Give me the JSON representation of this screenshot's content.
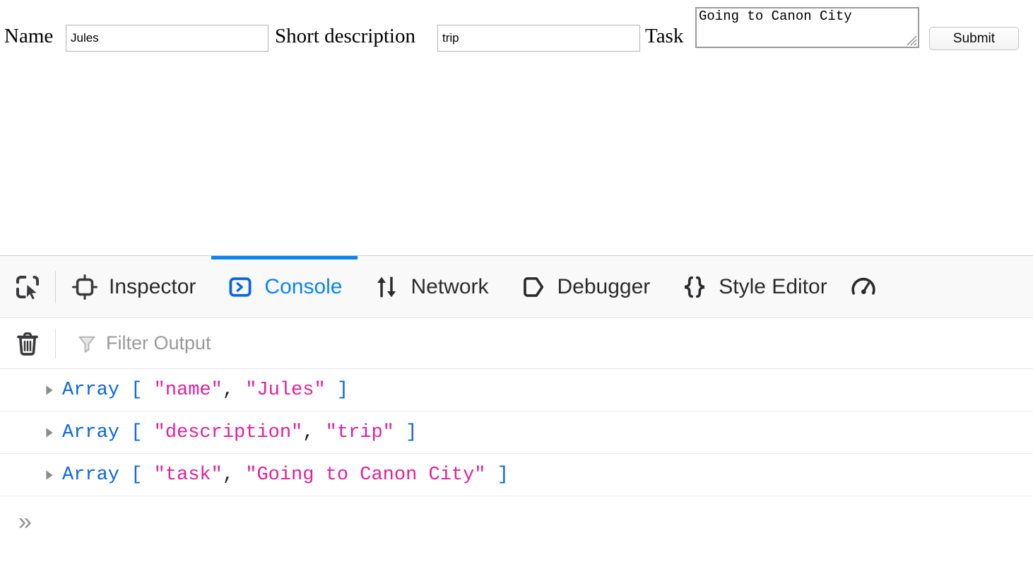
{
  "page": {
    "form": {
      "name_label": "Name",
      "name_value": "Jules",
      "name_placeholder": "",
      "description_label": "Short description",
      "description_value": "trip",
      "description_placeholder": "",
      "task_label": "Task",
      "task_value": "Going to Canon City",
      "task_placeholder": "",
      "submit_label": "Submit"
    }
  },
  "devtools": {
    "picker_icon": "element-picker-icon",
    "tabs": [
      {
        "label": "Inspector",
        "icon": "inspector-target-icon",
        "active": false
      },
      {
        "label": "Console",
        "icon": "console-chevron-box-icon",
        "active": true
      },
      {
        "label": "Network",
        "icon": "network-arrows-icon",
        "active": false
      },
      {
        "label": "Debugger",
        "icon": "debugger-tag-icon",
        "active": false
      },
      {
        "label": "Style Editor",
        "icon": "style-editor-braces-icon",
        "active": false
      },
      {
        "label": "",
        "icon": "performance-gauge-icon",
        "active": false
      }
    ],
    "filterbar": {
      "clear_icon": "trash-icon",
      "filter_icon": "funnel-icon",
      "filter_placeholder": "Filter Output",
      "filter_value": ""
    },
    "console_rows": [
      {
        "disclosure": "collapsed-triangle-icon",
        "type": "Array",
        "open": "[",
        "key": "\"name\"",
        "comma": ",",
        "value": "\"Jules\"",
        "close": "]"
      },
      {
        "disclosure": "collapsed-triangle-icon",
        "type": "Array",
        "open": "[",
        "key": "\"description\"",
        "comma": ",",
        "value": "\"trip\"",
        "close": "]"
      },
      {
        "disclosure": "collapsed-triangle-icon",
        "type": "Array",
        "open": "[",
        "key": "\"task\"",
        "comma": ",",
        "value": "\"Going to Canon City\"",
        "close": "]"
      }
    ],
    "prompt": "»"
  },
  "colors": {
    "accent_blue": "#0a84f3",
    "token_type_blue": "#0a66e0",
    "token_string_pink": "#e0219b",
    "toolbar_bg": "#f9f9fa",
    "muted_text": "#9a9a9a"
  }
}
